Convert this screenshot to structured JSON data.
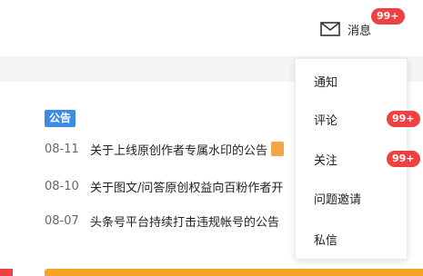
{
  "header": {
    "messages_label": "消息",
    "messages_badge": "99+"
  },
  "notice": {
    "tag_label": "公告",
    "items": [
      {
        "date": "08-11",
        "title": "关于上线原创作者专属水印的公告"
      },
      {
        "date": "08-10",
        "title": "关于图文/问答原创权益向百粉作者开"
      },
      {
        "date": "08-07",
        "title": "头条号平台持续打击违规帐号的公告"
      }
    ]
  },
  "dropdown": {
    "items": [
      {
        "label": "通知",
        "badge": ""
      },
      {
        "label": "评论",
        "badge": "99+"
      },
      {
        "label": "关注",
        "badge": "99+"
      },
      {
        "label": "问题邀请",
        "badge": ""
      },
      {
        "label": "私信",
        "badge": ""
      }
    ]
  },
  "colors": {
    "badge": "#f04142",
    "notice_tag": "#3c8ce7",
    "accent_orange": "#f5a524"
  }
}
